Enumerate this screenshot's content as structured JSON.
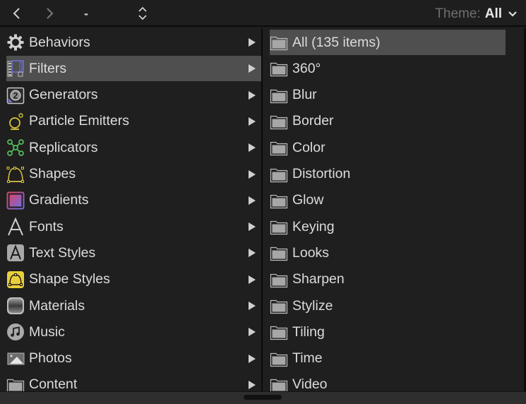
{
  "toolbar": {
    "back_icon": "chevron-left-icon",
    "forward_icon": "chevron-right-icon",
    "path_label": "-",
    "stepper_icon": "up-down-chevron-icon",
    "theme_label": "Theme:",
    "theme_value": "All",
    "theme_dropdown_icon": "chevron-down-icon"
  },
  "categories": [
    {
      "label": "Behaviors",
      "icon": "gear-icon",
      "selected": false
    },
    {
      "label": "Filters",
      "icon": "filmstrip-icon",
      "selected": true
    },
    {
      "label": "Generators",
      "icon": "generator-countdown-icon",
      "selected": false
    },
    {
      "label": "Particle Emitters",
      "icon": "particle-emitter-icon",
      "selected": false
    },
    {
      "label": "Replicators",
      "icon": "replicator-icon",
      "selected": false
    },
    {
      "label": "Shapes",
      "icon": "bezier-shape-icon",
      "selected": false
    },
    {
      "label": "Gradients",
      "icon": "gradient-icon",
      "selected": false
    },
    {
      "label": "Fonts",
      "icon": "font-letter-icon",
      "selected": false
    },
    {
      "label": "Text Styles",
      "icon": "text-style-icon",
      "selected": false
    },
    {
      "label": "Shape Styles",
      "icon": "shape-style-icon",
      "selected": false
    },
    {
      "label": "Materials",
      "icon": "material-icon",
      "selected": false
    },
    {
      "label": "Music",
      "icon": "music-note-icon",
      "selected": false
    },
    {
      "label": "Photos",
      "icon": "photo-icon",
      "selected": false
    },
    {
      "label": "Content",
      "icon": "folder-icon",
      "selected": false
    }
  ],
  "subcategories": [
    {
      "label": "All (135 items)",
      "selected": true
    },
    {
      "label": "360°",
      "selected": false
    },
    {
      "label": "Blur",
      "selected": false
    },
    {
      "label": "Border",
      "selected": false
    },
    {
      "label": "Color",
      "selected": false
    },
    {
      "label": "Distortion",
      "selected": false
    },
    {
      "label": "Glow",
      "selected": false
    },
    {
      "label": "Keying",
      "selected": false
    },
    {
      "label": "Looks",
      "selected": false
    },
    {
      "label": "Sharpen",
      "selected": false
    },
    {
      "label": "Stylize",
      "selected": false
    },
    {
      "label": "Tiling",
      "selected": false
    },
    {
      "label": "Time",
      "selected": false
    },
    {
      "label": "Video",
      "selected": false
    }
  ],
  "colors": {
    "background": "#1f1f1f",
    "selection": "#4f4f4f",
    "text": "#dcdcdc",
    "theme_label": "#6e6e6e",
    "particle_yellow": "#d9c43a",
    "replicator_green": "#52c05a",
    "filter_blue": "#6f72d6"
  }
}
